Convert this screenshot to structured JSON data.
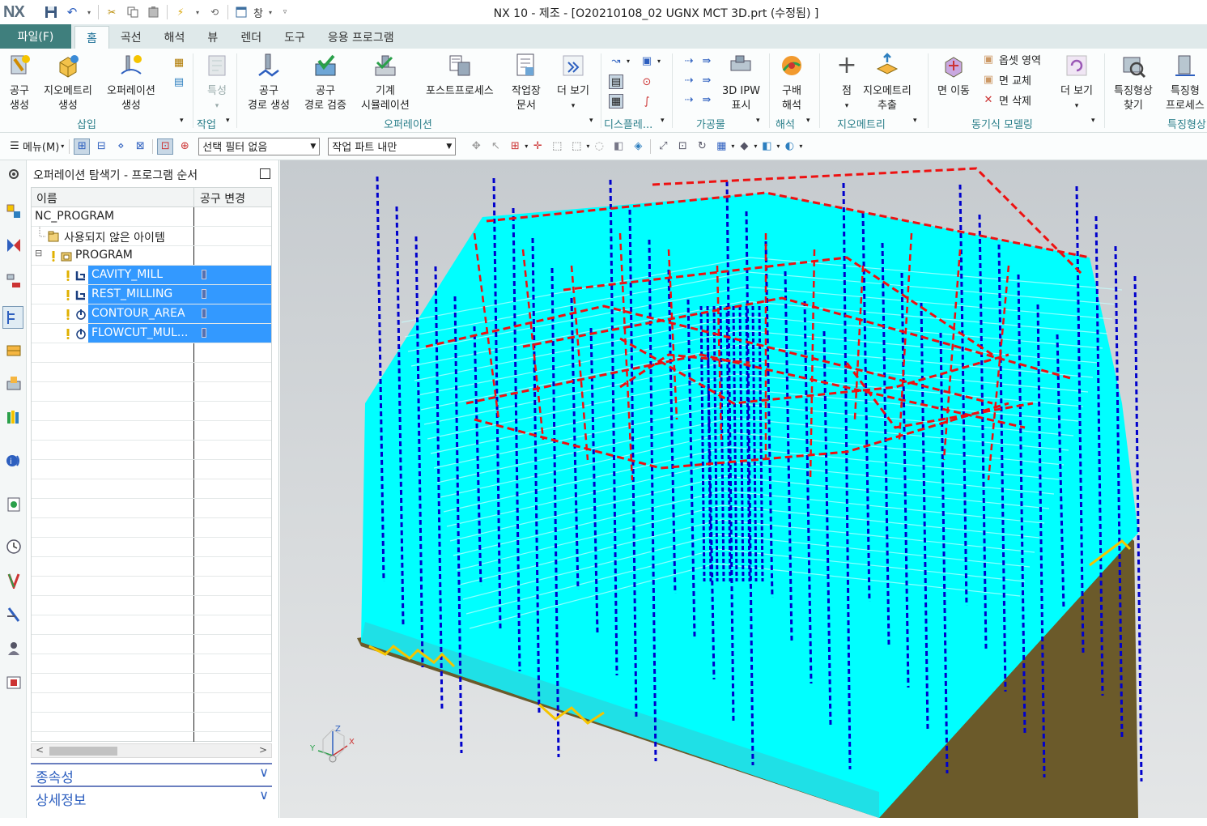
{
  "app": {
    "logo": "NX",
    "title": "NX 10 - 제조 - [O20210108_02 UGNX MCT 3D.prt (수정됨) ]",
    "window_menu": "창"
  },
  "tabs": {
    "file": "파일(F)",
    "items": [
      "홈",
      "곡선",
      "해석",
      "뷰",
      "렌더",
      "도구",
      "응용 프로그램"
    ],
    "active": "홈"
  },
  "ribbon": {
    "insert": {
      "tool_create": [
        "공구",
        "생성"
      ],
      "geometry_create": [
        "지오메트리",
        "생성"
      ],
      "operation_create": [
        "오퍼레이션",
        "생성"
      ],
      "group": "삽입"
    },
    "work": {
      "feature": "특성",
      "group": "작업"
    },
    "operation": {
      "toolpath_create": [
        "공구",
        "경로 생성"
      ],
      "toolpath_verify": [
        "공구",
        "경로 검증"
      ],
      "machine_sim": [
        "기계",
        "시뮬레이션"
      ],
      "postprocess": "포스트프로세스",
      "shop_doc": [
        "작업장",
        "문서"
      ],
      "more": "더 보기",
      "group": "오퍼레이션"
    },
    "display": {
      "group": "디스플레..."
    },
    "workpiece": {
      "ipw": [
        "3D IPW",
        "표시"
      ],
      "group": "가공물"
    },
    "analysis": {
      "gradient": [
        "구배",
        "해석"
      ],
      "group": "해석"
    },
    "geometry": {
      "point": "점",
      "extract": [
        "지오메트리",
        "추출"
      ],
      "group": "지오메트리"
    },
    "sync": {
      "move_face": "면 이동",
      "offset_region": "옵셋 영역",
      "replace_face": "면 교체",
      "delete_face": "면 삭제",
      "more": "더 보기",
      "group": "동기식 모델링"
    },
    "feature": {
      "find": [
        "특징형상",
        "찾기"
      ],
      "process": [
        "특징형",
        "프로세스"
      ],
      "group": "특징형상"
    }
  },
  "toolbar2": {
    "menu": "메뉴(M)",
    "selection_filter": "선택 필터 없음",
    "assembly_scope": "작업 파트 내만"
  },
  "navigator": {
    "title": "오퍼레이션 탐색기 - 프로그램 순서",
    "columns": [
      "이름",
      "공구 변경"
    ],
    "rows": [
      {
        "name": "NC_PROGRAM",
        "level": 0,
        "selected": false
      },
      {
        "name": "사용되지 않은 아이템",
        "level": 1,
        "selected": false
      },
      {
        "name": "PROGRAM",
        "level": 1,
        "selected": false
      },
      {
        "name": "CAVITY_MILL",
        "level": 2,
        "selected": true
      },
      {
        "name": "REST_MILLING",
        "level": 2,
        "selected": true
      },
      {
        "name": "CONTOUR_AREA",
        "level": 2,
        "selected": true
      },
      {
        "name": "FLOWCUT_MUL...",
        "level": 2,
        "selected": true
      }
    ],
    "panels": [
      "종속성",
      "상세정보"
    ]
  },
  "viewport": {
    "axis_labels": {
      "x": "X",
      "y": "Y",
      "z": "Z"
    },
    "colors": {
      "background_top": "#c6cbcf",
      "background_bottom": "#e4e6e7",
      "part": "#00ffff",
      "feed_path": "#0000cc",
      "rapid_path": "#ee1111",
      "base": "#6b5a2a",
      "engage": "#f5c400"
    }
  }
}
